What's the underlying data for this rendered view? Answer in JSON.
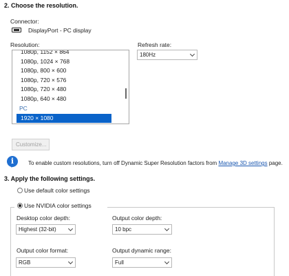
{
  "section2": {
    "title": "2. Choose the resolution.",
    "connector_label": "Connector:",
    "connector_value": "DisplayPort - PC display",
    "resolution_label": "Resolution:",
    "refresh_label": "Refresh rate:",
    "refresh_value": "180Hz",
    "resolutions": [
      "1080p, 1152 × 864",
      "1080p, 1024 × 768",
      "1080p, 800 × 600",
      "1080p, 720 × 576",
      "1080p, 720 × 480",
      "1080p, 640 × 480"
    ],
    "group_label": "PC",
    "selected_resolution": "1920 × 1080",
    "customize_label": "Customize...",
    "info_text_before": "To enable custom resolutions, turn off Dynamic Super Resolution factors from ",
    "info_link": "Manage 3D settings",
    "info_text_after": " page."
  },
  "section3": {
    "title": "3. Apply the following settings.",
    "radio_default": "Use default color settings",
    "radio_nvidia": "Use NVIDIA color settings",
    "selected_option": "nvidia",
    "desktop_color_depth_label": "Desktop color depth:",
    "desktop_color_depth_value": "Highest (32-bit)",
    "output_color_depth_label": "Output color depth:",
    "output_color_depth_value": "10 bpc",
    "output_color_format_label": "Output color format:",
    "output_color_format_value": "RGB",
    "output_dynamic_range_label": "Output dynamic range:",
    "output_dynamic_range_value": "Full"
  },
  "colors": {
    "selection": "#0a63c9",
    "link": "#1a57b0",
    "info_icon": "#1f6fd1"
  }
}
